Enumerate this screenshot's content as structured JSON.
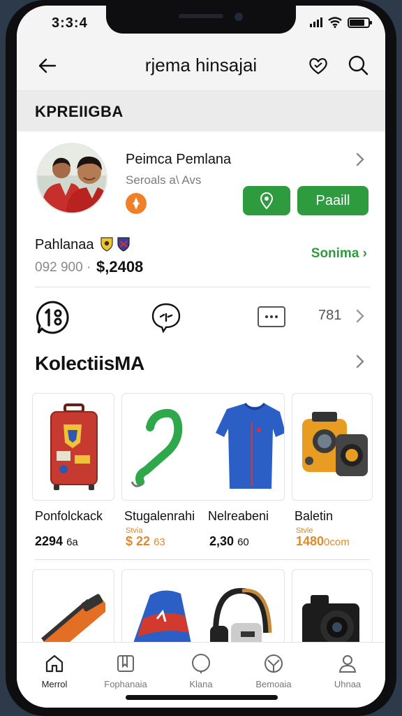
{
  "status": {
    "time": "3:3:4"
  },
  "nav": {
    "title": "rjema hinsajai"
  },
  "section": {
    "label": "KPREIIGBA"
  },
  "profile": {
    "name": "Peimca Pemlana",
    "subtitle": "Seroals a\\ Avs",
    "profile_button": "Paaill"
  },
  "balance": {
    "label": "Pahlanaa",
    "sub": "092 900 ·",
    "amount": "$,2408",
    "see_more": "Sonima ›"
  },
  "actions": {
    "count": "781"
  },
  "collection": {
    "title": "KolectiisMA",
    "items": [
      {
        "name": "Ponfolckack",
        "style": "",
        "price": "2294",
        "unit": "6a",
        "price_color": "dark"
      },
      {
        "name": "Stugalenrahi",
        "style": "Stvia",
        "price": "$ 22",
        "unit": "63",
        "price_color": "orange"
      },
      {
        "name": "Nelreabeni",
        "style": "",
        "price": "2,30",
        "unit": "60",
        "price_color": "dark"
      },
      {
        "name": "Baletin",
        "style": "Stvle",
        "price": "1480",
        "unit": "0com",
        "price_color": "orange"
      }
    ]
  },
  "tabs": [
    {
      "label": "Merrol",
      "icon": "home-icon"
    },
    {
      "label": "Fophanaia",
      "icon": "bookmark-icon"
    },
    {
      "label": "Klana",
      "icon": "comment-icon"
    },
    {
      "label": "Bemoaia",
      "icon": "badge-icon"
    },
    {
      "label": "Uhnaa",
      "icon": "user-icon"
    }
  ],
  "colors": {
    "accent": "#2d9b3e",
    "orange": "#e08a2a",
    "badge": "#f07f2a"
  }
}
